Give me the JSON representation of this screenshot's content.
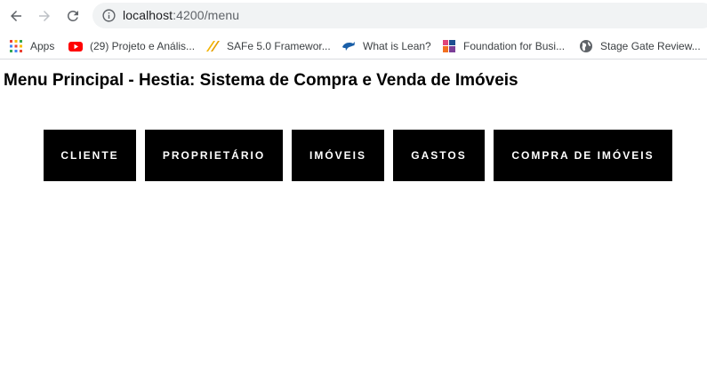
{
  "browser": {
    "url_host": "localhost",
    "url_rest": ":4200/menu"
  },
  "bookmarks": [
    {
      "label": "Apps",
      "icon": "apps-grid-icon"
    },
    {
      "label": "(29) Projeto e Anális...",
      "icon": "youtube-icon"
    },
    {
      "label": "SAFe 5.0 Framewor...",
      "icon": "safe-icon"
    },
    {
      "label": "What is Lean?",
      "icon": "dolphin-icon"
    },
    {
      "label": "Foundation for Busi...",
      "icon": "pmi-icon"
    },
    {
      "label": "Stage Gate Review...",
      "icon": "globe-icon"
    }
  ],
  "page": {
    "title": "Menu Principal - Hestia: Sistema de Compra e Venda de Imóveis",
    "menu_buttons": [
      "CLIENTE",
      "PROPRIETÁRIO",
      "IMÓVEIS",
      "GASTOS",
      "COMPRA DE IMÓVEIS"
    ]
  },
  "colors": {
    "button_bg": "#000000",
    "button_text": "#ffffff",
    "omnibox_bg": "#f1f3f4"
  }
}
